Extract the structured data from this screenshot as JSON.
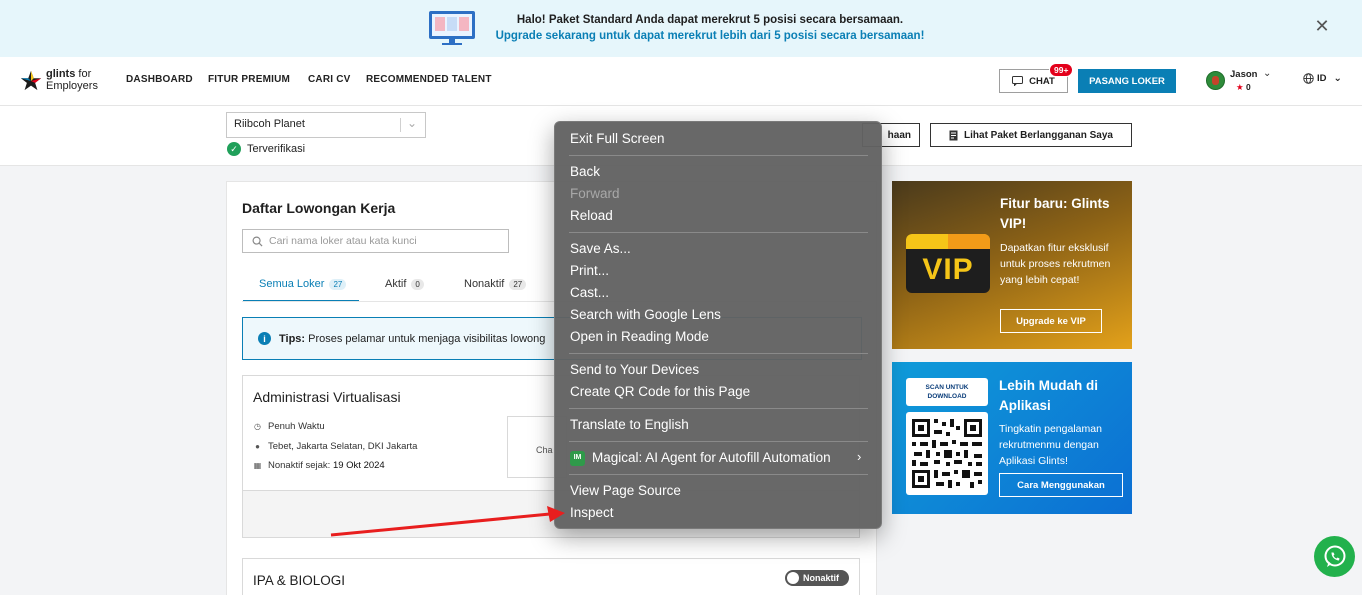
{
  "banner": {
    "line1": "Halo! Paket Standard Anda dapat merekrut 5 posisi secara bersamaan.",
    "line2": "Upgrade sekarang untuk dapat merekrut lebih dari 5 posisi secara bersamaan!",
    "close_icon": "close-icon"
  },
  "nav": {
    "logo_brand": "glints",
    "logo_for": "for",
    "logo_sub": "Employers",
    "links": [
      "DASHBOARD",
      "FITUR PREMIUM",
      "CARI CV",
      "RECOMMENDED TALENT"
    ],
    "chat_label": "CHAT",
    "chat_badge": "99+",
    "post_job_label": "PASANG LOKER",
    "user_name": "Jason",
    "user_points": "0",
    "language": "ID"
  },
  "subheader": {
    "company": "Riibcoh Planet",
    "verified": "Terverifikasi",
    "profile_btn_partial": "haan",
    "package_btn": "Lihat Paket Berlangganan Saya"
  },
  "jobs": {
    "title": "Daftar Lowongan Kerja",
    "search_placeholder": "Cari nama loker atau kata kunci",
    "tabs": [
      {
        "label": "Semua Loker",
        "count": "27"
      },
      {
        "label": "Aktif",
        "count": "0"
      },
      {
        "label": "Nonaktif",
        "count": "27"
      }
    ],
    "tips_label": "Tips:",
    "tips_text": "Proses pelamar untuk menjaga visibilitas lowong",
    "items": [
      {
        "title": "Administrasi Virtualisasi",
        "type": "Penuh Waktu",
        "location": "Tebet, Jakarta Selatan, DKI Jakarta",
        "inactive_label": "Nonaktif sejak:",
        "inactive_date": "19 Okt 2024",
        "stat_partial": "Cha"
      },
      {
        "title": "IPA & BIOLOGI",
        "status": "Nonaktif"
      }
    ]
  },
  "vip": {
    "badge": "VIP",
    "title": "Fitur baru: Glints VIP!",
    "desc": "Dapatkan fitur eksklusif untuk proses rekrutmen yang lebih cepat!",
    "button": "Upgrade ke VIP"
  },
  "app_promo": {
    "scan": "SCAN UNTUK DOWNLOAD",
    "title": "Lebih Mudah di Aplikasi",
    "desc": "Tingkatin pengalaman rekrutmenmu dengan Aplikasi Glints!",
    "button": "Cara Menggunakan"
  },
  "context_menu": {
    "items": {
      "exit_full_screen": "Exit Full Screen",
      "back": "Back",
      "forward": "Forward",
      "reload": "Reload",
      "save_as": "Save As...",
      "print": "Print...",
      "cast": "Cast...",
      "google_lens": "Search with Google Lens",
      "reading_mode": "Open in Reading Mode",
      "send_devices": "Send to Your Devices",
      "qr_code": "Create QR Code for this Page",
      "translate": "Translate to English",
      "magical": "Magical: AI Agent for Autofill Automation",
      "view_source": "View Page Source",
      "inspect": "Inspect"
    },
    "magical_icon_text": "IM"
  },
  "colors": {
    "accent": "#0a7fb5",
    "banner_bg": "#e6f6fb",
    "badge_red": "#e3001b",
    "whatsapp": "#22b14c",
    "arrow_red": "#e81e1e"
  }
}
